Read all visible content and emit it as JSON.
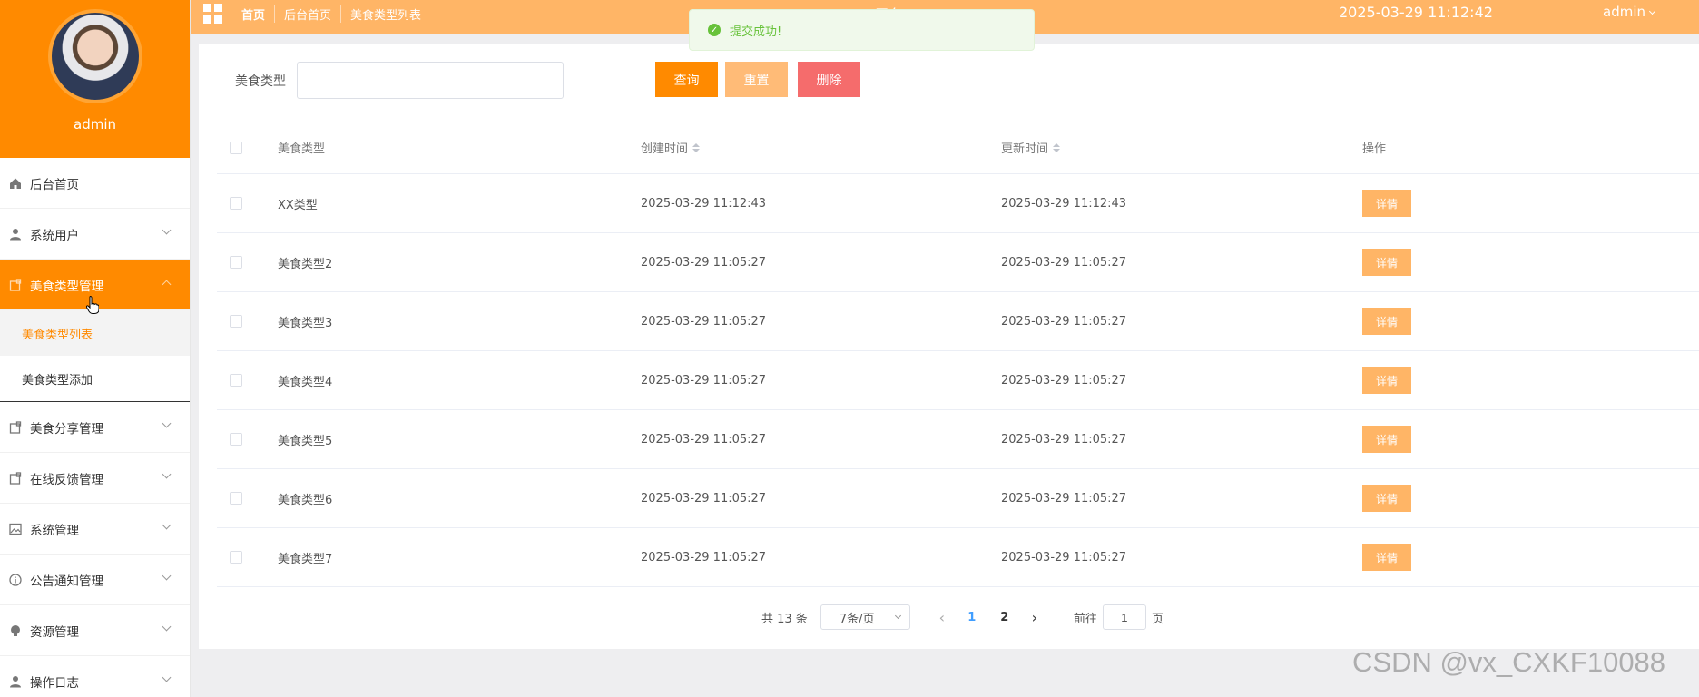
{
  "profile": {
    "username": "admin"
  },
  "sidebar": {
    "items": [
      {
        "label": "后台首页",
        "icon": "home-icon",
        "has_arrow": false
      },
      {
        "label": "系统用户",
        "icon": "user-icon",
        "has_arrow": true
      },
      {
        "label": "美食类型管理",
        "icon": "folder-icon",
        "has_arrow": true,
        "active": true
      },
      {
        "label": "美食分享管理",
        "icon": "folder-icon",
        "has_arrow": true
      },
      {
        "label": "在线反馈管理",
        "icon": "folder-icon",
        "has_arrow": true
      },
      {
        "label": "系统管理",
        "icon": "picture-icon",
        "has_arrow": true
      },
      {
        "label": "公告通知管理",
        "icon": "info-icon",
        "has_arrow": true
      },
      {
        "label": "资源管理",
        "icon": "bulb-icon",
        "has_arrow": true
      },
      {
        "label": "操作日志",
        "icon": "user-icon",
        "has_arrow": true
      }
    ],
    "submenu": [
      {
        "label": "美食类型列表",
        "current": true
      },
      {
        "label": "美食类型添加",
        "current": false
      }
    ]
  },
  "header": {
    "breadcrumbs": [
      "首页",
      "后台首页",
      "美食类型列表"
    ],
    "site_title": "...平台",
    "datetime": "2025-03-29 11:12:42",
    "user": "admin"
  },
  "toast": {
    "message": "提交成功!",
    "icon": "check-circle-icon"
  },
  "search": {
    "label": "美食类型",
    "value": "",
    "placeholder": "",
    "query_label": "查询",
    "reset_label": "重置",
    "delete_label": "删除"
  },
  "table": {
    "headers": {
      "name": "美食类型",
      "created": "创建时间",
      "updated": "更新时间",
      "ops": "操作"
    },
    "detail_label": "详情",
    "rows": [
      {
        "name": "XX类型",
        "created": "2025-03-29 11:12:43",
        "updated": "2025-03-29 11:12:43"
      },
      {
        "name": "美食类型2",
        "created": "2025-03-29 11:05:27",
        "updated": "2025-03-29 11:05:27"
      },
      {
        "name": "美食类型3",
        "created": "2025-03-29 11:05:27",
        "updated": "2025-03-29 11:05:27"
      },
      {
        "name": "美食类型4",
        "created": "2025-03-29 11:05:27",
        "updated": "2025-03-29 11:05:27"
      },
      {
        "name": "美食类型5",
        "created": "2025-03-29 11:05:27",
        "updated": "2025-03-29 11:05:27"
      },
      {
        "name": "美食类型6",
        "created": "2025-03-29 11:05:27",
        "updated": "2025-03-29 11:05:27"
      },
      {
        "name": "美食类型7",
        "created": "2025-03-29 11:05:27",
        "updated": "2025-03-29 11:05:27"
      }
    ]
  },
  "pagination": {
    "total": "共 13 条",
    "page_size": "7条/页",
    "pages": [
      "1",
      "2"
    ],
    "current": "1",
    "goto_prefix": "前往",
    "goto_value": "1",
    "goto_suffix": "页"
  },
  "watermark": "CSDN @vx_CXKF10088",
  "colors": {
    "primary": "#ff8a00",
    "header": "#ffb566",
    "danger": "#f56c6c",
    "success": "#67c23a"
  }
}
